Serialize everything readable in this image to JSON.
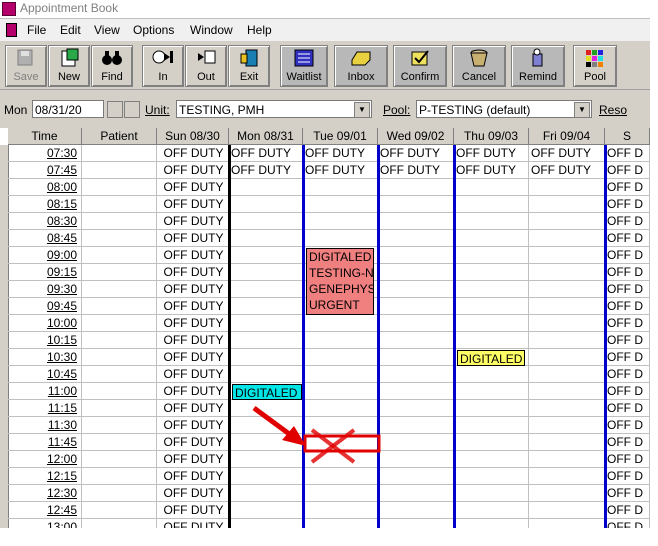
{
  "window": {
    "title": "Appointment Book"
  },
  "menu": [
    "File",
    "Edit",
    "View",
    "Options",
    "Window",
    "Help"
  ],
  "toolbar": {
    "buttons": [
      {
        "label": "Save",
        "icon": "save-icon",
        "disabled": true
      },
      {
        "label": "New",
        "icon": "new-appointment-icon"
      },
      {
        "label": "Find",
        "icon": "binoculars-icon"
      },
      {
        "label": "In",
        "icon": "check-in-icon"
      },
      {
        "label": "Out",
        "icon": "check-out-icon"
      },
      {
        "label": "Exit",
        "icon": "exit-door-icon"
      },
      {
        "label": "Waitlist",
        "icon": "waitlist-icon"
      },
      {
        "label": "Inbox",
        "icon": "inbox-tray-icon"
      },
      {
        "label": "Confirm",
        "icon": "confirm-check-icon"
      },
      {
        "label": "Cancel",
        "icon": "cancel-basket-icon"
      },
      {
        "label": "Remind",
        "icon": "remind-icon"
      },
      {
        "label": "Pool",
        "icon": "pool-grid-icon"
      }
    ]
  },
  "filters": {
    "day_label": "Mon",
    "date_value": "08/31/20",
    "unit_label": "Unit:",
    "unit_value": "TESTING, PMH",
    "pool_label": "Pool:",
    "pool_value": "P-TESTING (default)",
    "resource_label": "Reso"
  },
  "columns": [
    "Time",
    "Patient",
    "Sun 08/30",
    "Mon 08/31",
    "Tue 09/01",
    "Wed 09/02",
    "Thu 09/03",
    "Fri 09/04",
    "S"
  ],
  "times": [
    "07:30",
    "07:45",
    "08:00",
    "08:15",
    "08:30",
    "08:45",
    "09:00",
    "09:15",
    "09:30",
    "09:45",
    "10:00",
    "10:15",
    "10:30",
    "10:45",
    "11:00",
    "11:15",
    "11:30",
    "11:45",
    "12:00",
    "12:15",
    "12:30",
    "12:45",
    "13:00"
  ],
  "off_duty_label": "OFF DUTY",
  "off_duty_short": "OFF D",
  "appointments": [
    {
      "lines": [
        "DIGITALED",
        "TESTING-N",
        "GENEPHYS",
        "URGENT"
      ],
      "color": "#f08080"
    },
    {
      "lines": [
        "DIGITALED"
      ],
      "color": "#ffff66"
    },
    {
      "lines": [
        "DIGITALED"
      ],
      "color": "#00e5e5"
    }
  ],
  "colors": {
    "annotation_red": "#e00000",
    "column_divider_blue": "#0000cc"
  }
}
